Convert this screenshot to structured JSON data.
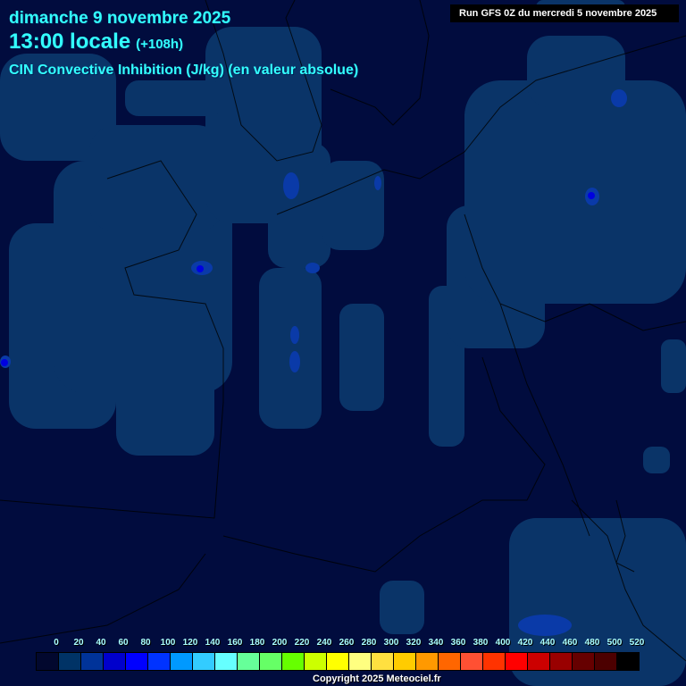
{
  "header": {
    "date": "dimanche 9 novembre 2025",
    "time": "13:00 locale",
    "lead": "(+108h)",
    "parameter": "CIN Convective Inhibition (J/kg) (en valeur absolue)",
    "run": "Run GFS 0Z du mercredi 5 novembre 2025"
  },
  "legend": {
    "labels": [
      "0",
      "20",
      "40",
      "60",
      "80",
      "100",
      "120",
      "140",
      "160",
      "180",
      "200",
      "220",
      "240",
      "260",
      "280",
      "300",
      "320",
      "340",
      "360",
      "380",
      "400",
      "420",
      "440",
      "460",
      "480",
      "500",
      "520"
    ],
    "colors": [
      "#02082e",
      "#003366",
      "#003399",
      "#0000cc",
      "#0000ff",
      "#0033ff",
      "#0099ff",
      "#33ccff",
      "#66ffff",
      "#66ff99",
      "#66ff66",
      "#66ff00",
      "#ccff00",
      "#ffff00",
      "#ffff80",
      "#ffe040",
      "#ffcc00",
      "#ff9900",
      "#ff6600",
      "#ff5033",
      "#ff3300",
      "#ff0000",
      "#cc0000",
      "#990000",
      "#660000",
      "#4c0000",
      "#000000"
    ]
  },
  "footer": {
    "copyright": "Copyright 2025 Meteociel.fr"
  }
}
